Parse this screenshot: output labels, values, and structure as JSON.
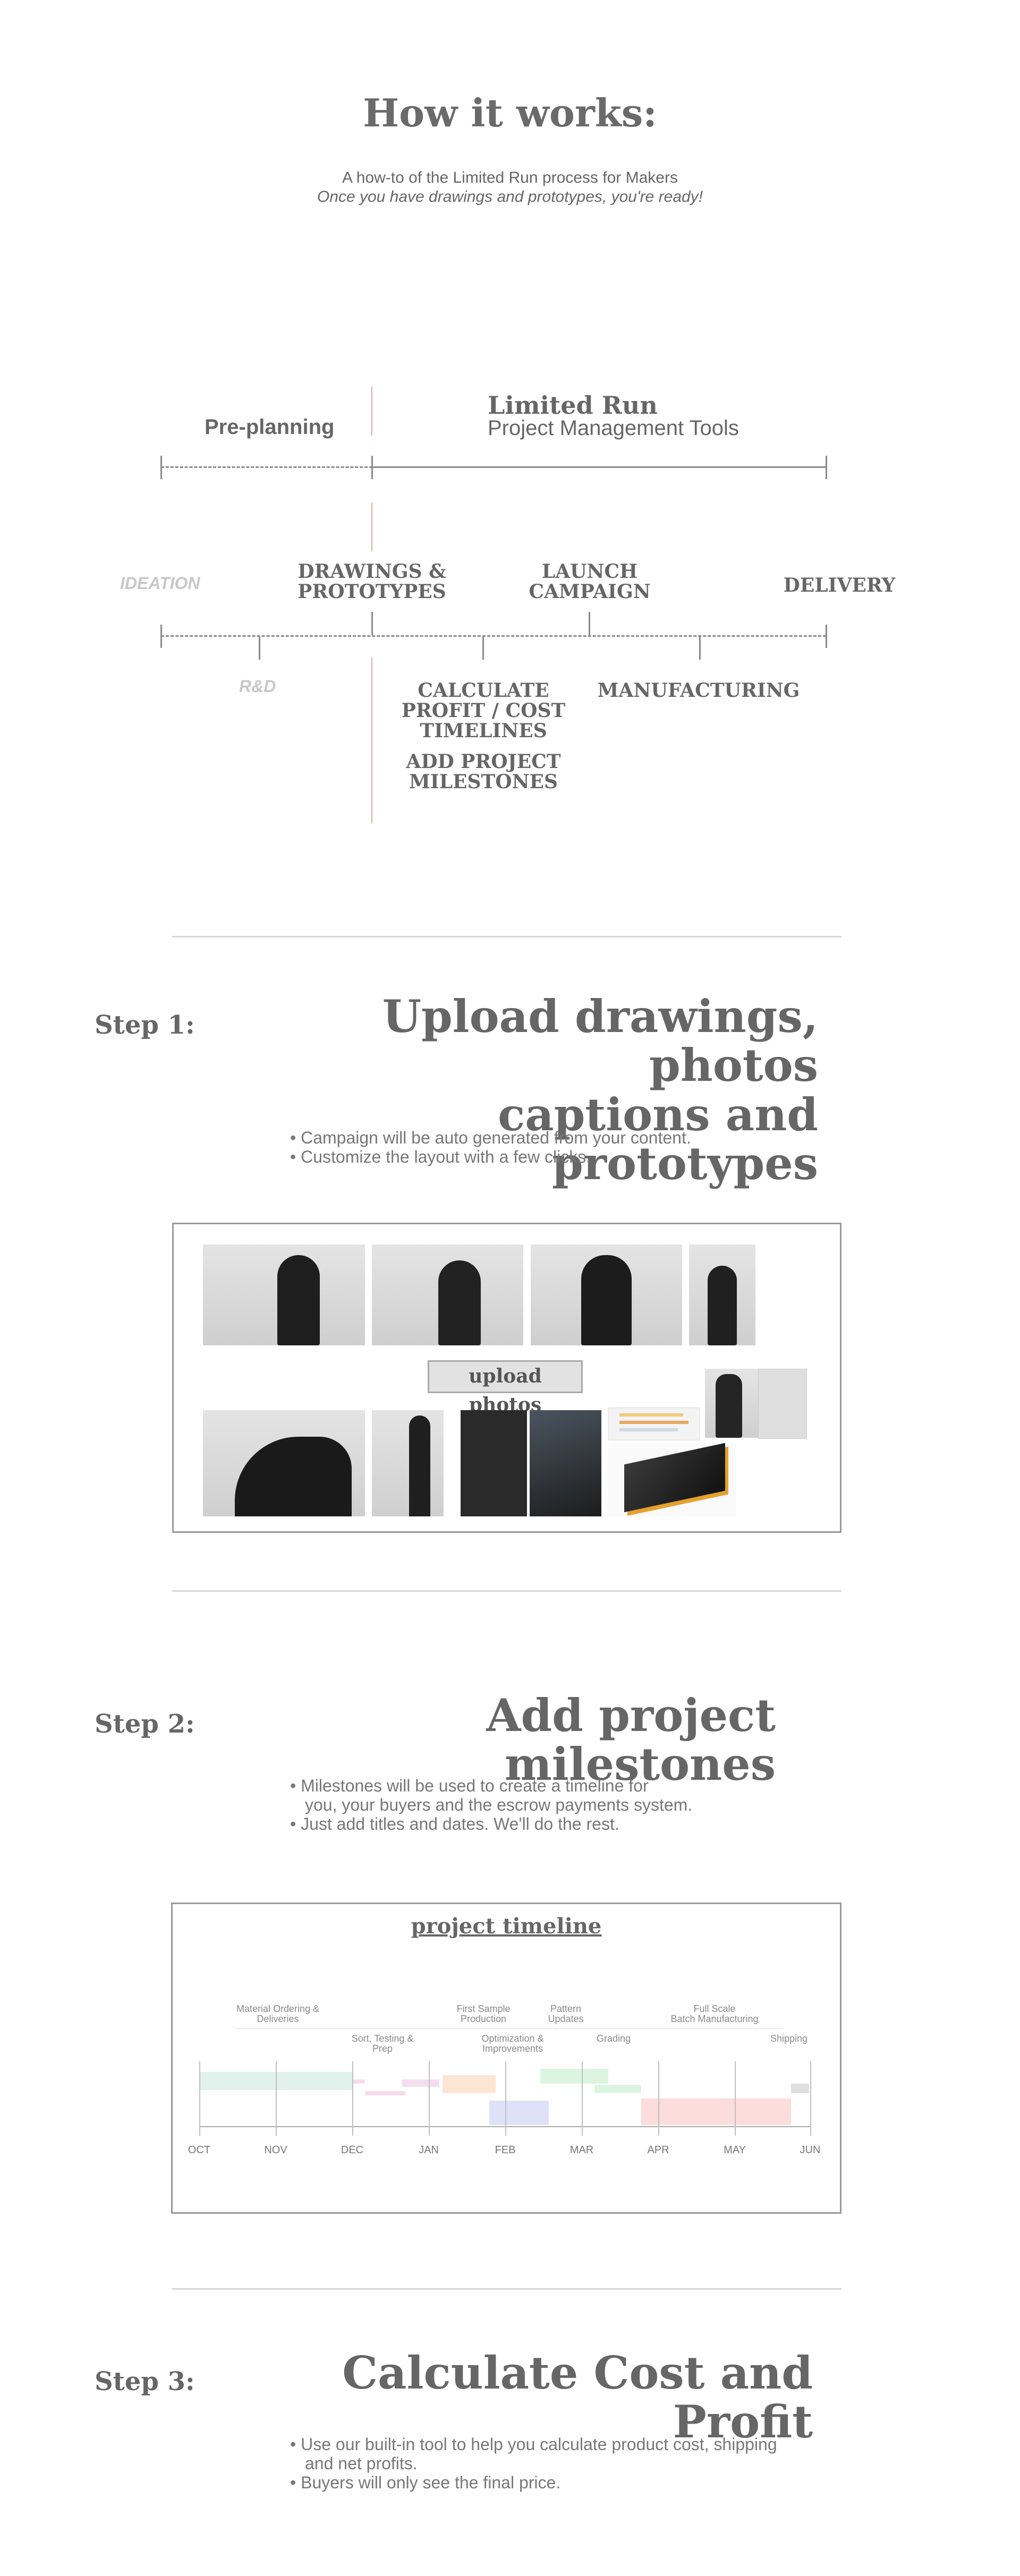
{
  "hero": {
    "title": "How it works:",
    "subtitle": "A how-to of the Limited Run process for Makers",
    "tagline": "Once you have drawings and prototypes, you're ready!"
  },
  "process": {
    "pre_planning": "Pre-planning",
    "limited_run": "Limited Run",
    "pm_tools": "Project Management Tools",
    "stages": {
      "ideation": "IDEATION",
      "drawings_1": "DRAWINGS &",
      "drawings_2": "PROTOTYPES",
      "launch_1": "LAUNCH",
      "launch_2": "CAMPAIGN",
      "delivery": "DELIVERY",
      "rnd": "R&D",
      "calc_1": "CALCULATE",
      "calc_2": "PROFIT / COST",
      "calc_3": "TIMELINES",
      "milestones_1": "ADD PROJECT",
      "milestones_2": "MILESTONES",
      "manufacturing": "MANUFACTURING"
    },
    "colors": {
      "accent_line": "#e9a7a7",
      "axis": "#8a8a8a"
    }
  },
  "step1": {
    "label": "Step 1:",
    "title_1": "Upload drawings, photos",
    "title_2": "captions and prototypes",
    "bullets": [
      "• Campaign will be auto generated from your content.",
      "• Customize the layout with a few clicks."
    ],
    "upload_button": "upload photos"
  },
  "step2": {
    "label": "Step 2:",
    "title": "Add project milestones",
    "bullets": [
      "• Milestones will be used to create a timeline for",
      "you, your buyers and the escrow payments system.",
      "• Just add titles and dates. We'll do the rest."
    ],
    "timeline": {
      "title": "project timeline",
      "months": [
        "OCT",
        "NOV",
        "DEC",
        "JAN",
        "FEB",
        "MAR",
        "APR",
        "MAY",
        "JUN"
      ],
      "milestones": {
        "material_1": "Material Ordering &",
        "material_2": "Deliveries",
        "sort_1": "Sort, Testing &",
        "sort_2": "Prep",
        "sample_1": "First Sample",
        "sample_2": "Production",
        "optim_1": "Optimization &",
        "optim_2": "Improvements",
        "pattern_1": "Pattern",
        "pattern_2": "Updates",
        "grading": "Grading",
        "fullscale_1": "Full Scale",
        "fullscale_2": "Batch Manufacturing",
        "shipping": "Shipping"
      }
    }
  },
  "step3": {
    "label": "Step 3:",
    "title": "Calculate Cost and Profit",
    "bullets": [
      "• Use our built-in tool to help you calculate product cost, shipping",
      "and net profits.",
      "• Buyers will only see the final price."
    ]
  }
}
